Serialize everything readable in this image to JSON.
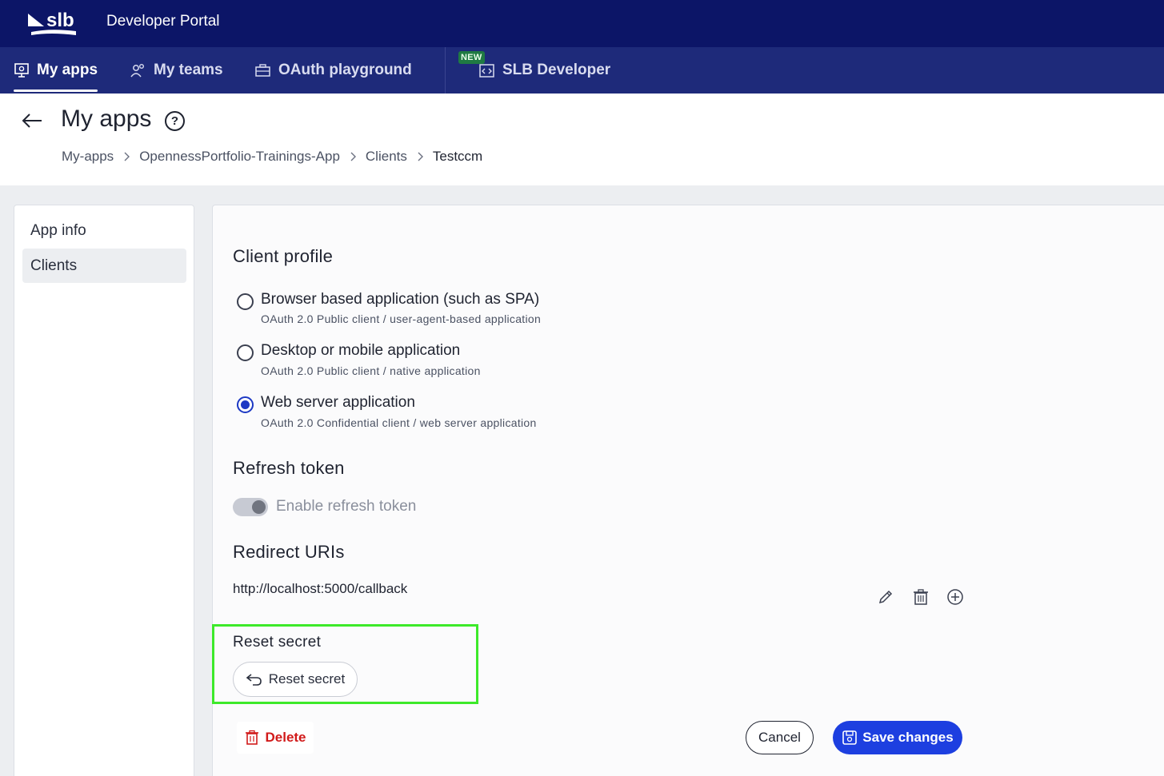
{
  "app": {
    "title": "Developer Portal",
    "logo_icon": "slb-logo"
  },
  "nav": {
    "items": [
      {
        "label": "My apps",
        "icon": "monitor-gear-icon",
        "active": true
      },
      {
        "label": "My teams",
        "icon": "users-icon",
        "active": false
      },
      {
        "label": "OAuth playground",
        "icon": "toolbox-icon",
        "active": false
      },
      {
        "label": "SLB Developer",
        "icon": "code-document-icon",
        "active": false,
        "badge": "NEW"
      }
    ]
  },
  "page": {
    "title": "My apps",
    "breadcrumb": [
      "My-apps",
      "OpennessPortfolio-Trainings-App",
      "Clients",
      "Testccm"
    ]
  },
  "sidebar": {
    "items": [
      {
        "label": "App info",
        "active": false
      },
      {
        "label": "Clients",
        "active": true
      }
    ]
  },
  "client_profile": {
    "title": "Client profile",
    "options": [
      {
        "label": "Browser based application (such as SPA)",
        "desc": "OAuth 2.0 Public client / user-agent-based application",
        "checked": false
      },
      {
        "label": "Desktop or mobile application",
        "desc": "OAuth 2.0 Public client / native application",
        "checked": false
      },
      {
        "label": "Web server application",
        "desc": "OAuth 2.0 Confidential client / web server application",
        "checked": true
      }
    ]
  },
  "refresh_token": {
    "title": "Refresh token",
    "toggle_label": "Enable refresh token",
    "enabled": true,
    "disabled": true
  },
  "redirect_uris": {
    "title": "Redirect URIs",
    "items": [
      "http://localhost:5000/callback"
    ]
  },
  "reset_secret": {
    "title": "Reset secret",
    "button_label": "Reset secret"
  },
  "actions": {
    "delete_label": "Delete",
    "cancel_label": "Cancel",
    "save_label": "Save changes"
  },
  "colors": {
    "topbar": "#0c1567",
    "navbar": "#1e2a7a",
    "primary": "#1d3fe0",
    "danger": "#d11a1a",
    "highlight": "#3de92a",
    "new_badge": "#1f7a43"
  }
}
